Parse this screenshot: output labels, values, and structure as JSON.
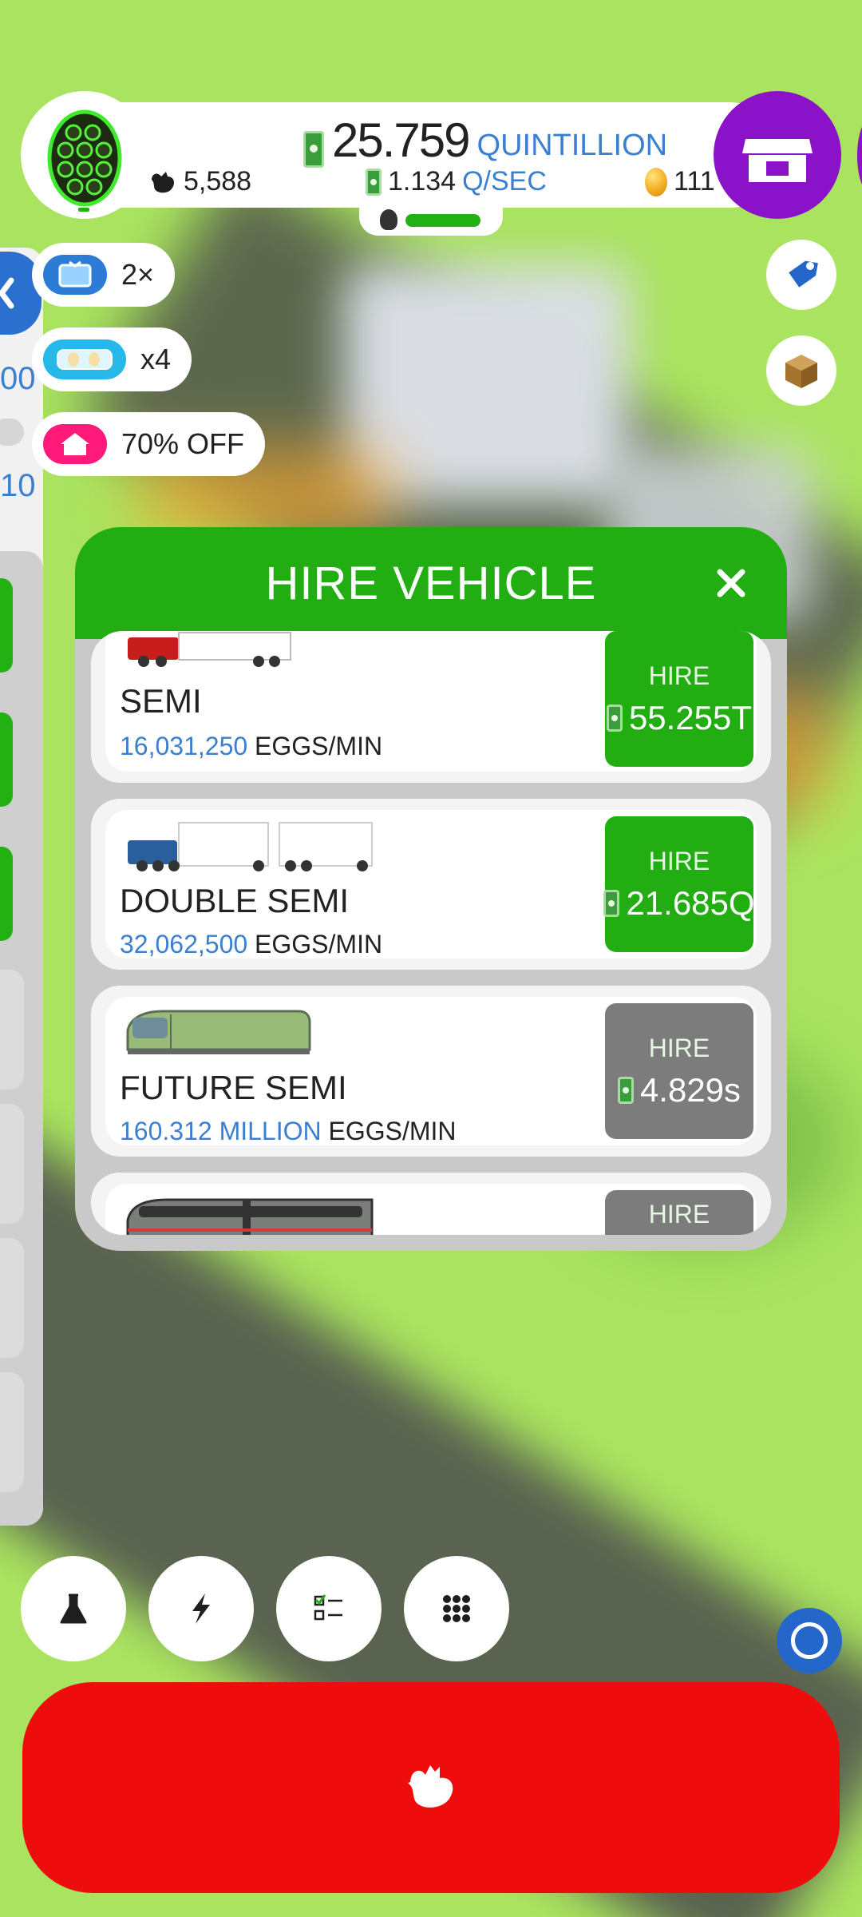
{
  "header": {
    "money_value": "25.759",
    "money_unit": "QUINTILLION",
    "chickens": "5,588",
    "rate_value": "1.134",
    "rate_unit": "Q/SEC",
    "golden_eggs": "111"
  },
  "side": {
    "text_a": "00",
    "text_b": "10"
  },
  "boosts": [
    {
      "icon": "tv-icon",
      "label": "2×"
    },
    {
      "icon": "egg-boost-icon",
      "label": "x4"
    },
    {
      "icon": "house-discount-icon",
      "label": "70% OFF"
    }
  ],
  "modal": {
    "title": "HIRE VEHICLE",
    "hire_label": "HIRE",
    "vehicles": [
      {
        "name": "SEMI",
        "rate": "16,031,250",
        "rate_unit": "EGGS/MIN",
        "cost": "55.255T",
        "affordable": true
      },
      {
        "name": "DOUBLE SEMI",
        "rate": "32,062,500",
        "rate_unit": "EGGS/MIN",
        "cost": "21.685Q",
        "affordable": true
      },
      {
        "name": "FUTURE SEMI",
        "rate": "160.312 MILLION",
        "rate_unit": "EGGS/MIN",
        "cost": "4.829s",
        "affordable": false
      },
      {
        "name": "",
        "rate": "",
        "rate_unit": "",
        "cost": "",
        "affordable": false
      }
    ]
  },
  "nav": {
    "buttons": [
      "research-flask-icon",
      "boost-lightning-icon",
      "missions-checklist-icon",
      "menu-grid-icon"
    ]
  },
  "colors": {
    "grass": "#a9e35f",
    "hire_green": "#22ad12",
    "hire_grey": "#7c7c7c",
    "accent_blue": "#3b7fd0",
    "shop_purple": "#8a12c9",
    "hatch_red": "#ef0c0c"
  }
}
